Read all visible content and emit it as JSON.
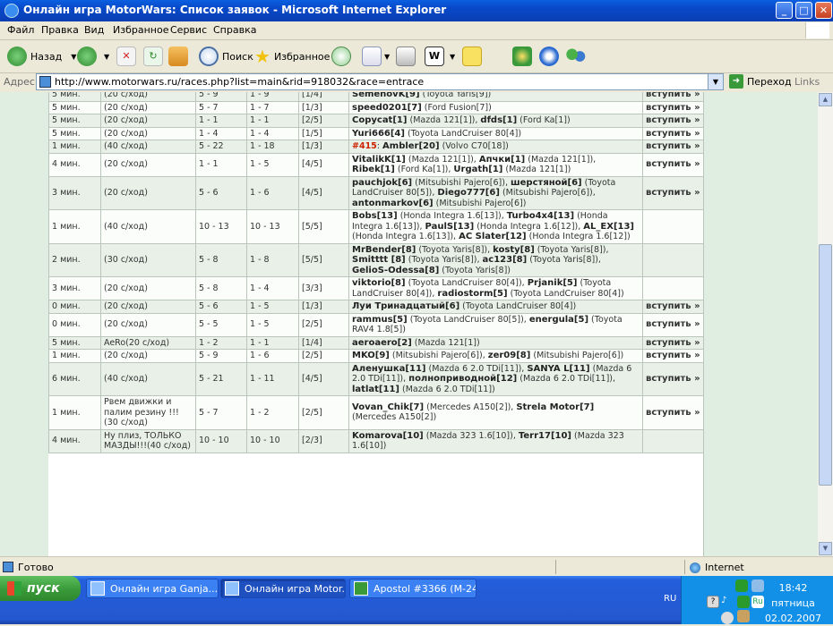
{
  "window": {
    "title": "Онлайн игра MotorWars: Список заявок - Microsoft Internet Explorer",
    "controls": [
      "_",
      "□",
      "✕"
    ]
  },
  "menu": [
    "Файл",
    "Правка",
    "Вид",
    "Избранное",
    "Сервис",
    "Справка"
  ],
  "toolbar": {
    "back_label": "Назад",
    "search_label": "Поиск",
    "favorites_label": "Избранное"
  },
  "address": {
    "label": "Адрес:",
    "url": "http://www.motorwars.ru/races.php?list=main&rid=918032&race=entrace",
    "go_label": "Переход",
    "links_label": "Links"
  },
  "races": [
    {
      "time": "5 мин.",
      "mode": "(20 с/ход)",
      "levels": "5 - 9",
      "range": "1 - 9",
      "slots": "[1/4]",
      "racers": [
        {
          "name": "SemenovK[9]",
          "car": "(Toyota Yaris[9])"
        }
      ],
      "action": "вступить »",
      "shade": "g"
    },
    {
      "time": "5 мин.",
      "mode": "(20 с/ход)",
      "levels": "5 - 7",
      "range": "1 - 7",
      "slots": "[1/3]",
      "racers": [
        {
          "name": "speed0201[7]",
          "car": "(Ford Fusion[7])"
        }
      ],
      "action": "вступить »",
      "shade": "w"
    },
    {
      "time": "5 мин.",
      "mode": "(20 с/ход)",
      "levels": "1 - 1",
      "range": "1 - 1",
      "slots": "[2/5]",
      "racers": [
        {
          "name": "Copycat[1]",
          "car": "(Mazda 121[1]),"
        },
        {
          "name": "dfds[1]",
          "car": "(Ford Ka[1])"
        }
      ],
      "action": "вступить »",
      "shade": "g"
    },
    {
      "time": "5 мин.",
      "mode": "(20 с/ход)",
      "levels": "1 - 4",
      "range": "1 - 4",
      "slots": "[1/5]",
      "racers": [
        {
          "name": "Yuri666[4]",
          "car": "(Toyota LandCruiser 80[4])"
        }
      ],
      "action": "вступить »",
      "shade": "w"
    },
    {
      "time": "1 мин.",
      "mode": "(40 с/ход)",
      "levels": "5 - 22",
      "range": "1 - 18",
      "slots": "[1/3]",
      "prefix": "#415",
      "racers": [
        {
          "name": "Ambler[20]",
          "car": "(Volvo C70[18])"
        }
      ],
      "action": "вступить »",
      "shade": "g"
    },
    {
      "time": "4 мин.",
      "mode": "(20 с/ход)",
      "levels": "1 - 1",
      "range": "1 - 5",
      "slots": "[4/5]",
      "racers": [
        {
          "name": "VitalikK[1]",
          "car": "(Mazda 121[1]),"
        },
        {
          "name": "Апчки[1]",
          "car": "(Mazda 121[1]),"
        },
        {
          "name": "Ribek[1]",
          "car": "(Ford Ka[1]),"
        },
        {
          "name": "Urgath[1]",
          "car": "(Mazda 121[1])"
        }
      ],
      "action": "вступить »",
      "shade": "w"
    },
    {
      "time": "3 мин.",
      "mode": "(20 с/ход)",
      "levels": "5 - 6",
      "range": "1 - 6",
      "slots": "[4/5]",
      "racers": [
        {
          "name": "pauchjok[6]",
          "car": "(Mitsubishi Pajero[6]),"
        },
        {
          "name": "шерстяной[6]",
          "car": "(Toyota LandCruiser 80[5]),"
        },
        {
          "name": "Diego777[6]",
          "car": "(Mitsubishi Pajero[6]),"
        },
        {
          "name": "antonmarkov[6]",
          "car": "(Mitsubishi Pajero[6])"
        }
      ],
      "action": "вступить »",
      "shade": "g"
    },
    {
      "time": "1 мин.",
      "mode": "(40 с/ход)",
      "levels": "10 - 13",
      "range": "10 - 13",
      "slots": "[5/5]",
      "racers": [
        {
          "name": "Bobs[13]",
          "car": "(Honda Integra 1.6[13]),"
        },
        {
          "name": "Turbo4x4[13]",
          "car": "(Honda Integra 1.6[13]),"
        },
        {
          "name": "PaulS[13]",
          "car": "(Honda Integra 1.6[12]),"
        },
        {
          "name": "AL_EX[13]",
          "car": "(Honda Integra 1.6[13]),"
        },
        {
          "name": "AC Slater[12]",
          "car": "(Honda Integra 1.6[12])"
        }
      ],
      "action": "",
      "shade": "w"
    },
    {
      "time": "2 мин.",
      "mode": "(30 с/ход)",
      "levels": "5 - 8",
      "range": "1 - 8",
      "slots": "[5/5]",
      "racers": [
        {
          "name": "MrBender[8]",
          "car": "(Toyota Yaris[8]),"
        },
        {
          "name": "kosty[8]",
          "car": "(Toyota Yaris[8]),"
        },
        {
          "name": "Smitttt [8]",
          "car": "(Toyota Yaris[8]),"
        },
        {
          "name": "ac123[8]",
          "car": "(Toyota Yaris[8]),"
        },
        {
          "name": "GelioS-Odessa[8]",
          "car": "(Toyota Yaris[8])"
        }
      ],
      "action": "",
      "shade": "g"
    },
    {
      "time": "3 мин.",
      "mode": "(20 с/ход)",
      "levels": "5 - 8",
      "range": "1 - 4",
      "slots": "[3/3]",
      "racers": [
        {
          "name": "viktorio[8]",
          "car": "(Toyota LandCruiser 80[4]),"
        },
        {
          "name": "Prjanik[5]",
          "car": "(Toyota LandCruiser 80[4]),"
        },
        {
          "name": "radiostorm[5]",
          "car": "(Toyota LandCruiser 80[4])"
        }
      ],
      "action": "",
      "shade": "w"
    },
    {
      "time": "0 мин.",
      "mode": "(20 с/ход)",
      "levels": "5 - 6",
      "range": "1 - 5",
      "slots": "[1/3]",
      "racers": [
        {
          "name": "Луи Тринадцатый[6]",
          "car": "(Toyota LandCruiser 80[4])"
        }
      ],
      "action": "вступить »",
      "shade": "g"
    },
    {
      "time": "0 мин.",
      "mode": "(20 с/ход)",
      "levels": "5 - 5",
      "range": "1 - 5",
      "slots": "[2/5]",
      "racers": [
        {
          "name": "rammus[5]",
          "car": "(Toyota LandCruiser 80[5]),"
        },
        {
          "name": "energula[5]",
          "car": "(Toyota RAV4 1.8[5])"
        }
      ],
      "action": "вступить »",
      "shade": "w"
    },
    {
      "time": "5 мин.",
      "mode": "AeRo(20 с/ход)",
      "levels": "1 - 2",
      "range": "1 - 1",
      "slots": "[1/4]",
      "racers": [
        {
          "name": "aeroaero[2]",
          "car": "(Mazda 121[1])"
        }
      ],
      "action": "вступить »",
      "shade": "g"
    },
    {
      "time": "1 мин.",
      "mode": "(20 с/ход)",
      "levels": "5 - 9",
      "range": "1 - 6",
      "slots": "[2/5]",
      "racers": [
        {
          "name": "MKO[9]",
          "car": "(Mitsubishi Pajero[6]),"
        },
        {
          "name": "zer09[8]",
          "car": "(Mitsubishi Pajero[6])"
        }
      ],
      "action": "вступить »",
      "shade": "w"
    },
    {
      "time": "6 мин.",
      "mode": "(40 с/ход)",
      "levels": "5 - 21",
      "range": "1 - 11",
      "slots": "[4/5]",
      "racers": [
        {
          "name": "Аленушка[11]",
          "car": "(Mazda 6 2.0 TDi[11]),"
        },
        {
          "name": "SANYA L[11]",
          "car": "(Mazda 6 2.0 TDi[11]),"
        },
        {
          "name": "полноприводной[12]",
          "car": "(Mazda 6 2.0 TDi[11]),"
        },
        {
          "name": "latlat[11]",
          "car": "(Mazda 6 2.0 TDi[11])"
        }
      ],
      "action": "вступить »",
      "shade": "g"
    },
    {
      "time": "1 мин.",
      "mode": "Рвем движки и палим резину !!!(30 с/ход)",
      "levels": "5 - 7",
      "range": "1 - 2",
      "slots": "[2/5]",
      "racers": [
        {
          "name": "Vovan_Chik[7]",
          "car": "(Mercedes A150[2]),"
        },
        {
          "name": "Strela Motor[7]",
          "car": "(Mercedes A150[2])"
        }
      ],
      "action": "вступить »",
      "shade": "w"
    },
    {
      "time": "4 мин.",
      "mode": "Ну плиз, ТОЛЬКО МАЗДЫ!!!(40 с/ход)",
      "levels": "10 - 10",
      "range": "10 - 10",
      "slots": "[2/3]",
      "racers": [
        {
          "name": "Komarova[10]",
          "car": "(Mazda 323 1.6[10]),"
        },
        {
          "name": "Terr17[10]",
          "car": "(Mazda 323 1.6[10])"
        }
      ],
      "action": "",
      "shade": "g"
    }
  ],
  "status": {
    "text": "Готово",
    "zone": "Internet"
  },
  "taskbar": {
    "start_label": "пуск",
    "tasks": [
      "Онлайн игра Ganja...",
      "Онлайн игра Motor...",
      "Apostol #3366 (M-24..."
    ],
    "lang": "RU",
    "time": "18:42",
    "day": "пятница",
    "date": "02.02.2007"
  }
}
